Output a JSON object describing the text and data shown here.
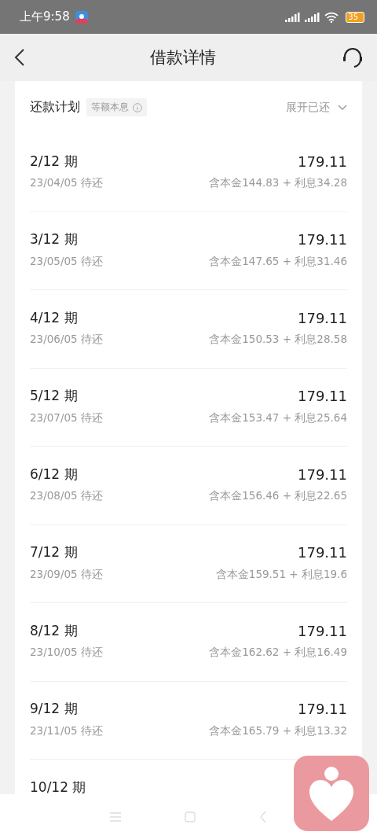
{
  "status_bar": {
    "time": "上午9:58",
    "battery": "35"
  },
  "nav": {
    "title": "借款详情"
  },
  "plan": {
    "title": "还款计划",
    "tag": "等额本息",
    "toggle": "展开已还"
  },
  "installments": [
    {
      "period": "2/12 期",
      "amount": "179.11",
      "date": "23/04/05 待还",
      "detail": "含本金144.83 + 利息34.28"
    },
    {
      "period": "3/12 期",
      "amount": "179.11",
      "date": "23/05/05 待还",
      "detail": "含本金147.65 + 利息31.46"
    },
    {
      "period": "4/12 期",
      "amount": "179.11",
      "date": "23/06/05 待还",
      "detail": "含本金150.53 + 利息28.58"
    },
    {
      "period": "5/12 期",
      "amount": "179.11",
      "date": "23/07/05 待还",
      "detail": "含本金153.47 + 利息25.64"
    },
    {
      "period": "6/12 期",
      "amount": "179.11",
      "date": "23/08/05 待还",
      "detail": "含本金156.46 + 利息22.65"
    },
    {
      "period": "7/12 期",
      "amount": "179.11",
      "date": "23/09/05 待还",
      "detail": "含本金159.51 + 利息19.6"
    },
    {
      "period": "8/12 期",
      "amount": "179.11",
      "date": "23/10/05 待还",
      "detail": "含本金162.62 + 利息16.49"
    },
    {
      "period": "9/12 期",
      "amount": "179.11",
      "date": "23/11/05 待还",
      "detail": "含本金165.79 + 利息13.32"
    },
    {
      "period": "10/12 期"
    }
  ]
}
